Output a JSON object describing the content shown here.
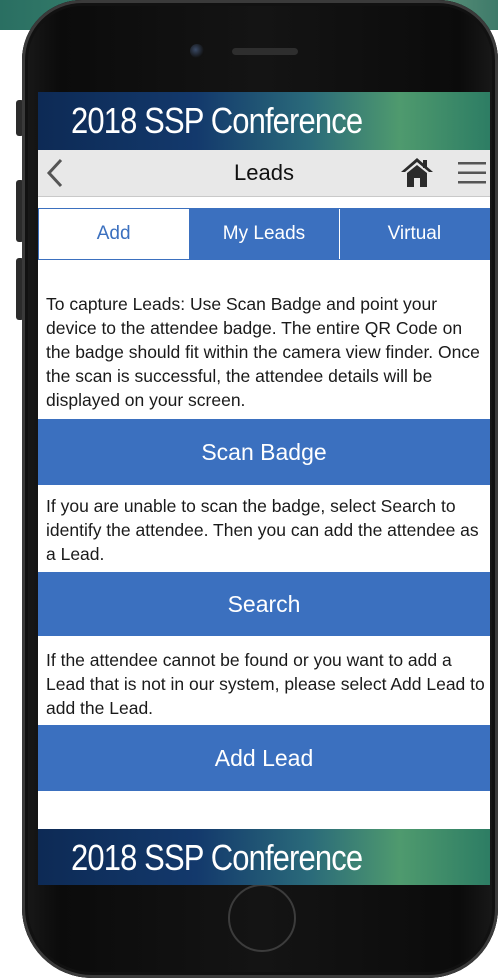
{
  "banner": {
    "title": "2018 SSP Conference"
  },
  "nav": {
    "title": "Leads",
    "back_icon": "chevron-left-icon",
    "home_icon": "home-icon",
    "menu_icon": "hamburger-menu-icon"
  },
  "tabs": [
    {
      "label": "Add",
      "active": true
    },
    {
      "label": "My Leads",
      "active": false
    },
    {
      "label": "Virtual",
      "active": false
    }
  ],
  "instructions": {
    "scan": "To capture Leads: Use Scan Badge and point your device to the attendee badge. The entire QR Code on the badge should fit within the camera view finder. Once the scan is successful, the attendee details will be displayed on your screen.",
    "search": "If you are unable to scan the badge, select Search to identify the attendee. Then you can add the attendee as a Lead.",
    "add": "If the attendee cannot be found or you want to add a Lead that is not in our system, please select Add Lead to add the Lead."
  },
  "buttons": {
    "scan_badge": "Scan Badge",
    "search": "Search",
    "add_lead": "Add Lead"
  },
  "footer_banner": {
    "title": "2018 SSP Conference"
  },
  "colors": {
    "accent": "#3b70bf",
    "navbar_bg": "#e8e8e8",
    "banner_dark": "#13396c"
  }
}
